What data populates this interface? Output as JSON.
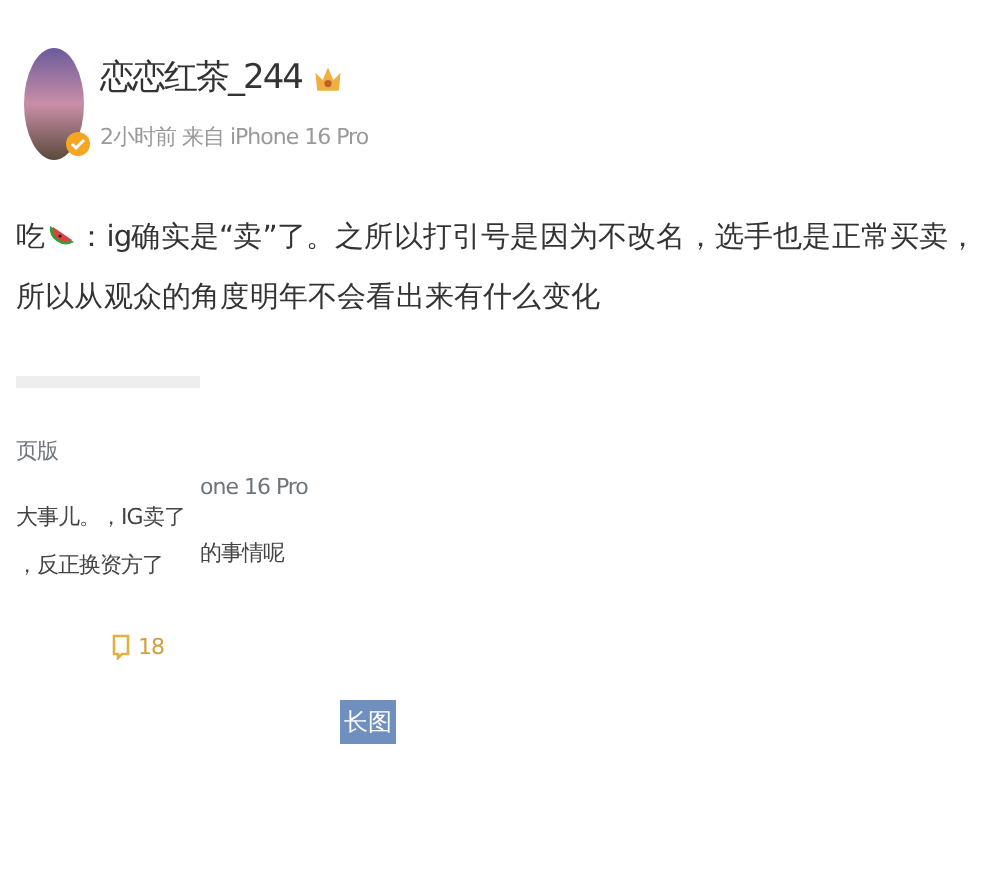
{
  "author": {
    "name": "恋恋红茶_244",
    "verified": true,
    "meta": "2小时前 来自 iPhone 16 Pro"
  },
  "post": {
    "prefix": "吃",
    "text": "：ig确实是“卖”了。之所以打引号是因为不改名，选手也是正常买卖，所以从观众的角度明年不会看出来有什么变化"
  },
  "screenshot_left": {
    "header": "页版",
    "lines": [
      "大事儿。，IG卖了",
      "，反正换资方了"
    ],
    "comment_count": "18"
  },
  "screenshot_right": {
    "meta": "one 16 Pro",
    "line": "的事情呢"
  },
  "long_image_badge": "长图"
}
